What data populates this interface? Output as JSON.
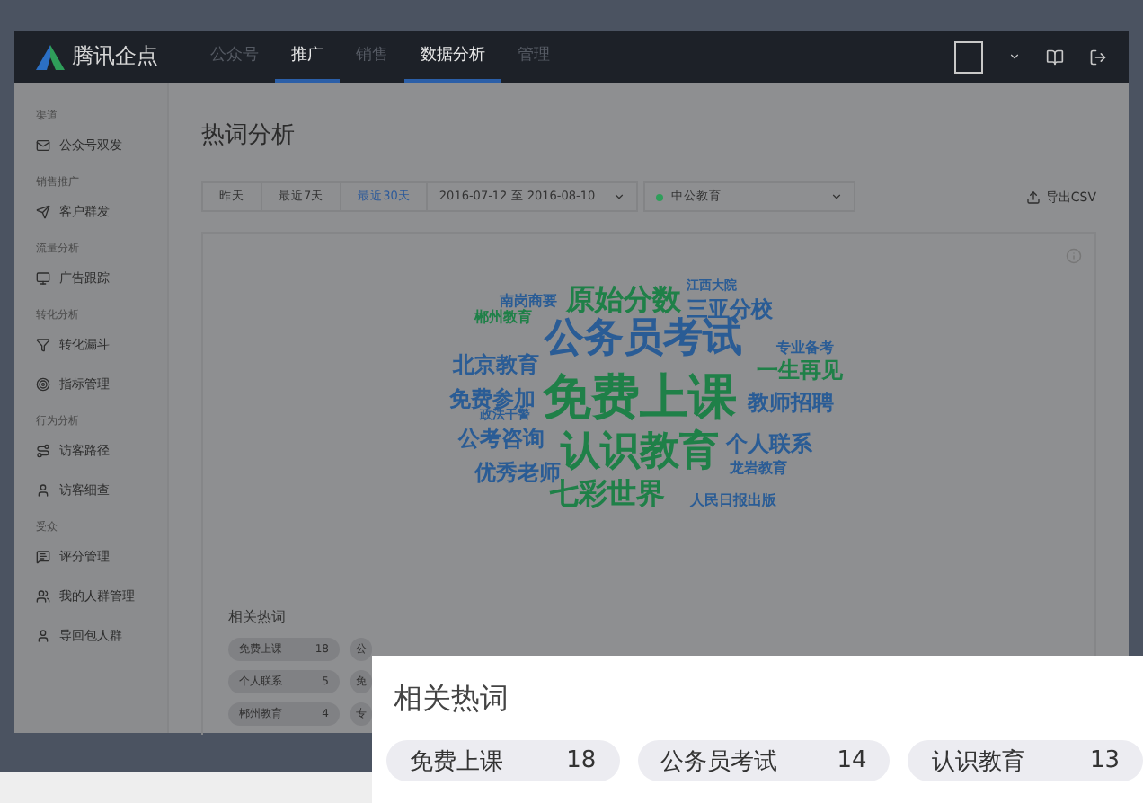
{
  "navbar": {
    "logo": "腾讯企点",
    "tabs": [
      {
        "label": "公众号",
        "selected": false
      },
      {
        "label": "推广",
        "selected": true
      },
      {
        "label": "销售",
        "selected": false
      },
      {
        "label": "数据分析",
        "selected": true
      },
      {
        "label": "管理",
        "selected": false
      }
    ]
  },
  "sidebar": {
    "groups": [
      {
        "heading": "渠道",
        "items": [
          {
            "label": "公众号双发"
          }
        ]
      },
      {
        "heading": "销售推广",
        "items": [
          {
            "label": "客户群发"
          }
        ]
      },
      {
        "heading": "流量分析",
        "items": [
          {
            "label": "广告跟踪"
          }
        ]
      },
      {
        "heading": "转化分析",
        "items": [
          {
            "label": "转化漏斗"
          },
          {
            "label": "指标管理"
          }
        ]
      },
      {
        "heading": "行为分析",
        "items": [
          {
            "label": "访客路径"
          },
          {
            "label": "访客细查"
          }
        ]
      },
      {
        "heading": "受众",
        "items": [
          {
            "label": "评分管理"
          },
          {
            "label": "我的人群管理"
          },
          {
            "label": "导回包人群"
          }
        ]
      }
    ]
  },
  "page": {
    "title": "热词分析",
    "ranges": [
      {
        "label": "昨天",
        "selected": false
      },
      {
        "label": "最近7天",
        "selected": false
      },
      {
        "label": "最近30天",
        "selected": true
      }
    ],
    "date_range": "2016-07-12 至 2016-08-10",
    "account": {
      "label": "中公教育",
      "color": "#2f9e5a"
    },
    "export": "导出CSV"
  },
  "word_cloud": [
    {
      "text": "南岗商要",
      "kind": "small",
      "color": "#2a5c95"
    },
    {
      "text": "原始分数",
      "kind": "large",
      "color": "#1f8048"
    },
    {
      "text": "江西大院",
      "kind": "tiny",
      "color": "#2a5c95"
    },
    {
      "text": "郴州教育",
      "kind": "small",
      "color": "#1f8048"
    },
    {
      "text": "三亚分校",
      "kind": "medium",
      "color": "#2a5c95"
    },
    {
      "text": "公务员考试",
      "kind": "huge",
      "color": "#2a5c95"
    },
    {
      "text": "专业备考",
      "kind": "small",
      "color": "#2a5c95"
    },
    {
      "text": "北京教育",
      "kind": "medium",
      "color": "#2a5c95"
    },
    {
      "text": "一生再见",
      "kind": "medium",
      "color": "#1f8048"
    },
    {
      "text": "免费参加",
      "kind": "medium",
      "color": "#2a5c95"
    },
    {
      "text": "免费上课",
      "kind": "giant",
      "color": "#1f8048"
    },
    {
      "text": "教师招聘",
      "kind": "medium",
      "color": "#2a5c95"
    },
    {
      "text": "政法干警",
      "kind": "tiny",
      "color": "#2a5c95"
    },
    {
      "text": "公考咨询",
      "kind": "medium",
      "color": "#2a5c95"
    },
    {
      "text": "认识教育",
      "kind": "huge",
      "color": "#1f8048"
    },
    {
      "text": "个人联系",
      "kind": "medium",
      "color": "#2a5c95"
    },
    {
      "text": "优秀老师",
      "kind": "medium",
      "color": "#2a5c95"
    },
    {
      "text": "龙岩教育",
      "kind": "small",
      "color": "#2a5c95"
    },
    {
      "text": "七彩世界",
      "kind": "large",
      "color": "#1f8048"
    },
    {
      "text": "人民日报出版",
      "kind": "small",
      "color": "#2a5c95"
    }
  ],
  "related": {
    "title": "相关热词",
    "rows": [
      [
        {
          "word": "免费上课",
          "count": "18"
        },
        {
          "word": "公"
        }
      ],
      [
        {
          "word": "个人联系",
          "count": "5"
        },
        {
          "word": "免"
        }
      ],
      [
        {
          "word": "郴州教育",
          "count": "4"
        },
        {
          "word": "专"
        }
      ]
    ]
  },
  "callout": {
    "title": "相关热词",
    "chips": [
      {
        "word": "免费上课",
        "count": "18"
      },
      {
        "word": "公务员考试",
        "count": "14"
      },
      {
        "word": "认识教育",
        "count": "13"
      }
    ]
  }
}
